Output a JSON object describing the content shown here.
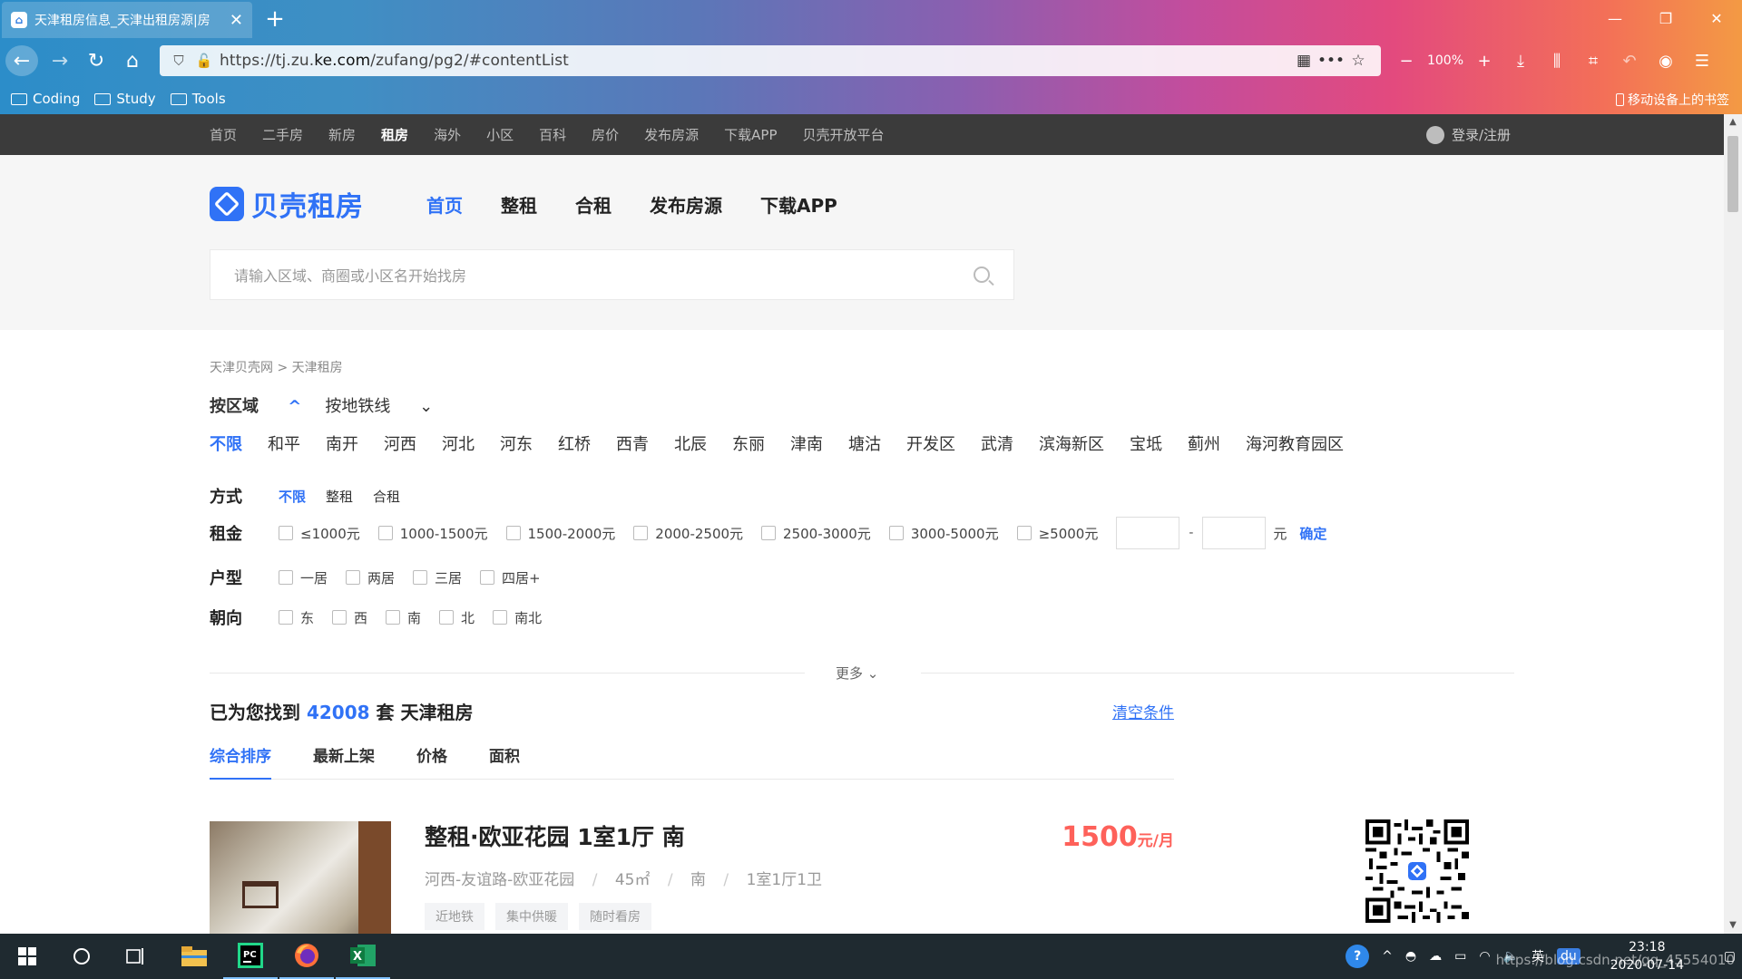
{
  "browser": {
    "tab_title": "天津租房信息_天津出租房源|房",
    "url_prefix": "https://tj.zu.",
    "url_domain": "ke.com",
    "url_path": "/zufang/pg2/#contentList",
    "zoom": "100%",
    "bookmarks": [
      "Coding",
      "Study",
      "Tools"
    ],
    "mobile_bookmarks": "移动设备上的书签"
  },
  "topnav": {
    "items": [
      "首页",
      "二手房",
      "新房",
      "租房",
      "海外",
      "小区",
      "百科",
      "房价",
      "发布房源",
      "下载APP",
      "贝壳开放平台"
    ],
    "active_index": 3,
    "login": "登录/注册"
  },
  "header": {
    "logo_text": "贝壳租房",
    "nav": [
      "首页",
      "整租",
      "合租",
      "发布房源",
      "下载APP"
    ],
    "search_placeholder": "请输入区域、商圈或小区名开始找房"
  },
  "breadcrumb": "天津贝壳网 >  天津租房",
  "filter_tabs": [
    "按区域",
    "按地铁线"
  ],
  "regions": [
    "不限",
    "和平",
    "南开",
    "河西",
    "河北",
    "河东",
    "红桥",
    "西青",
    "北辰",
    "东丽",
    "津南",
    "塘沽",
    "开发区",
    "武清",
    "滨海新区",
    "宝坻",
    "蓟州",
    "海河教育园区"
  ],
  "filters": {
    "mode": {
      "label": "方式",
      "options": [
        "不限",
        "整租",
        "合租"
      ]
    },
    "rent": {
      "label": "租金",
      "options": [
        "≤1000元",
        "1000-1500元",
        "1500-2000元",
        "2000-2500元",
        "2500-3000元",
        "3000-5000元",
        "≥5000元"
      ],
      "unit": "元",
      "confirm": "确定"
    },
    "layout": {
      "label": "户型",
      "options": [
        "一居",
        "两居",
        "三居",
        "四居+"
      ]
    },
    "orientation": {
      "label": "朝向",
      "options": [
        "东",
        "西",
        "南",
        "北",
        "南北"
      ]
    }
  },
  "more": "更多",
  "result": {
    "prefix": "已为您找到",
    "count": "42008",
    "suffix": "套 天津租房",
    "clear": "清空条件"
  },
  "sort_tabs": [
    "综合排序",
    "最新上架",
    "价格",
    "面积"
  ],
  "listing": {
    "title": "整租·欧亚花园 1室1厅 南",
    "location": "河西-友谊路-欧亚花园",
    "area": "45㎡",
    "orientation": "南",
    "layout": "1室1厅1卫",
    "tags": [
      "近地铁",
      "集中供暖",
      "随时看房"
    ],
    "price": "1500",
    "price_unit": "元/月"
  },
  "taskbar": {
    "time": "23:18",
    "date": "2020-07-14",
    "ime": "英",
    "watermark": "https://blog.csdn.net/qq_45554010"
  }
}
